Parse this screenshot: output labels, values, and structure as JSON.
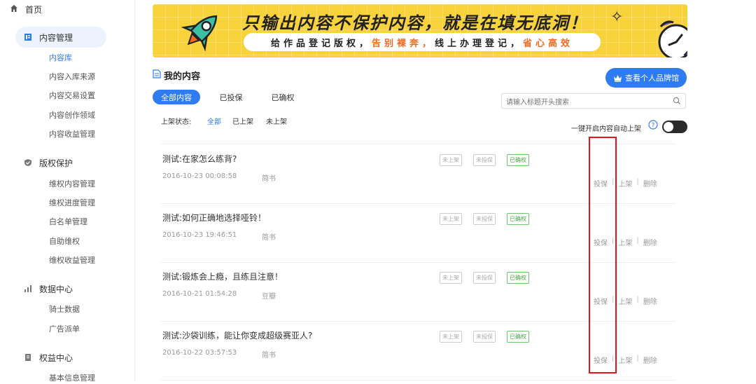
{
  "sidebar": {
    "home": "首页",
    "groups": [
      {
        "label": "内容管理",
        "icon": "content-icon",
        "items": [
          "内容库",
          "内容入库来源",
          "内容交易设置",
          "内容创作领域",
          "内容收益管理"
        ]
      },
      {
        "label": "版权保护",
        "icon": "shield-icon",
        "items": [
          "维权内容管理",
          "维权进度管理",
          "白名单管理",
          "自助维权",
          "维权收益管理"
        ]
      },
      {
        "label": "数据中心",
        "icon": "bar-chart-icon",
        "items": [
          "骑士数据",
          "广告派单"
        ]
      },
      {
        "label": "权益中心",
        "icon": "rights-icon",
        "items": [
          "基本信息管理"
        ]
      }
    ]
  },
  "banner": {
    "title": "只输出内容不保护内容，就是在填无底洞！",
    "sub_part1": "给作品登记版权，",
    "sub_part2": "告别裸奔，",
    "sub_part3": "线上办理登记，",
    "sub_part4": "省心高效",
    "accent_color": "#f06a22",
    "bg_color": "#f7d23b"
  },
  "main": {
    "title": "我的内容",
    "brand_button": "查看个人品牌馆",
    "tabs": [
      "全部内容",
      "已投保",
      "已确权"
    ],
    "search_placeholder": "请输入标题开头搜索",
    "filter_label": "上架状态:",
    "filters": [
      "全部",
      "已上架",
      "未上架"
    ],
    "auto_label": "一键开启内容自动上架"
  },
  "rows": [
    {
      "title": "测试:在家怎么练背?",
      "date": "2016-10-23 00:08:58",
      "source": "简书",
      "tags": [
        "未上架",
        "未投保",
        "已确权"
      ],
      "actions": [
        "投保",
        "上架",
        "删除"
      ]
    },
    {
      "title": "测试:如何正确地选择哑铃！",
      "date": "2016-10-23 19:46:51",
      "source": "简书",
      "tags": [
        "未上架",
        "未投保",
        "已确权"
      ],
      "actions": [
        "投保",
        "上架",
        "删除"
      ]
    },
    {
      "title": "测试:锻炼会上瘾，且练且注意！",
      "date": "2016-10-21 01:54:28",
      "source": "豆瓣",
      "tags": [
        "未上架",
        "未投保",
        "已确权"
      ],
      "actions": [
        "投保",
        "上架",
        "删除"
      ]
    },
    {
      "title": "测试:沙袋训练，能让你变成超级赛亚人?",
      "date": "2016-10-22 03:57:53",
      "source": "简书",
      "tags": [
        "未上架",
        "未投保",
        "已确权"
      ],
      "actions": [
        "投保",
        "上架",
        "删除"
      ]
    }
  ],
  "colors": {
    "primary": "#2f7bf1",
    "highlight_box": "#e8121d",
    "green_tag": "#4aa44a"
  }
}
